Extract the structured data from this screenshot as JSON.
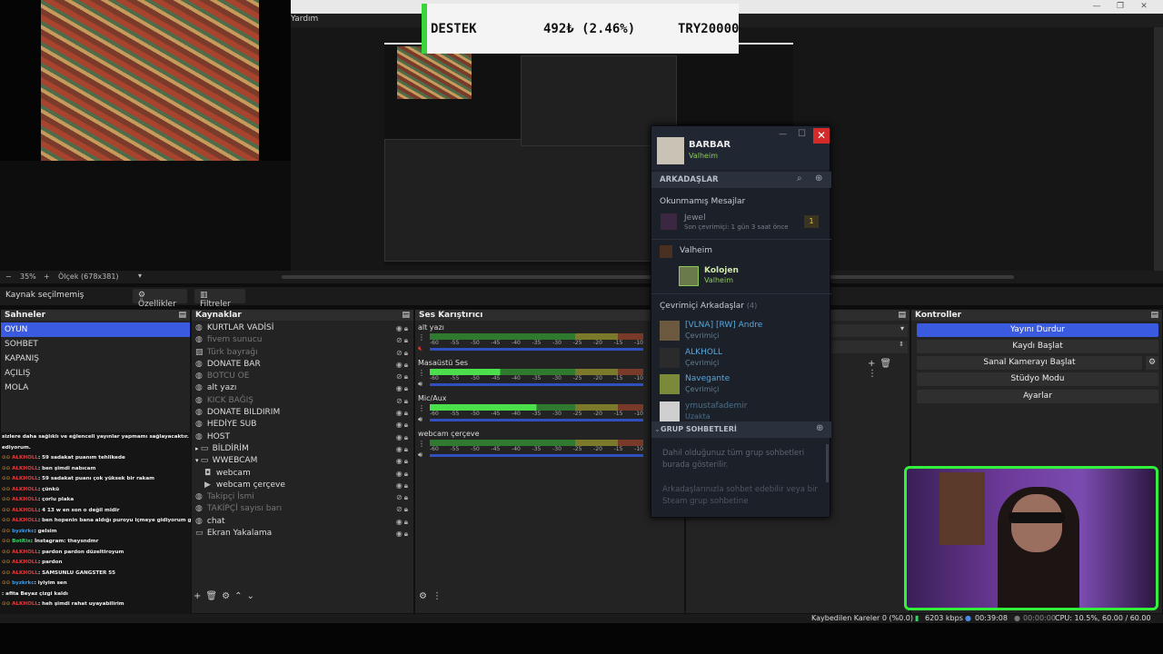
{
  "menu": {
    "help": "Yardım"
  },
  "donation": {
    "label": "DESTEK",
    "progress": "492₺ (2.46%)",
    "goal": "TRY20000"
  },
  "scalebar": {
    "zoom": "35%",
    "scale": "Ölçek (678x381)",
    "minus": "−",
    "plus": "+"
  },
  "source_bar": {
    "none_selected": "Kaynak seçilmemiş",
    "properties": "Özellikler",
    "filters": "Filtreler"
  },
  "scenes": {
    "title": "Sahneler",
    "items": [
      {
        "label": "OYUN",
        "selected": true
      },
      {
        "label": "SOHBET"
      },
      {
        "label": "KAPANIŞ"
      },
      {
        "label": "AÇILIŞ"
      },
      {
        "label": "MOLA"
      }
    ]
  },
  "sources": {
    "title": "Kaynaklar",
    "items": [
      {
        "label": "KURTLAR VADİSİ",
        "icon": "globe"
      },
      {
        "label": "fivem sunucu",
        "icon": "globe",
        "dim": true
      },
      {
        "label": "Türk bayrağı",
        "icon": "image",
        "dim": true
      },
      {
        "label": "DONATE BAR",
        "icon": "globe"
      },
      {
        "label": "BOTCU OE",
        "icon": "globe",
        "dim": true
      },
      {
        "label": "alt yazı",
        "icon": "globe"
      },
      {
        "label": "KICK BAĞIŞ",
        "icon": "globe",
        "dim": true
      },
      {
        "label": "DONATE BILDIRIM",
        "icon": "globe"
      },
      {
        "label": "HEDİYE SUB",
        "icon": "globe"
      },
      {
        "label": "HOST",
        "icon": "globe"
      },
      {
        "label": "BİLDİRİM",
        "icon": "folder",
        "group": "closed"
      },
      {
        "label": "WWEBCAM",
        "icon": "folder",
        "group": "open"
      },
      {
        "label": "webcam",
        "icon": "camera",
        "indent": true
      },
      {
        "label": "webcam çerçeve",
        "icon": "play",
        "indent": true
      },
      {
        "label": "Takipçi İsmi",
        "icon": "globe",
        "dim": true
      },
      {
        "label": "TAKİPÇİ sayısı barı",
        "icon": "globe",
        "dim": true
      },
      {
        "label": "chat",
        "icon": "globe"
      },
      {
        "label": "Ekran Yakalama",
        "icon": "monitor"
      }
    ]
  },
  "mixer": {
    "title": "Ses Karıştırıcı",
    "ticks": [
      "-60",
      "-55",
      "-50",
      "-45",
      "-40",
      "-35",
      "-30",
      "-25",
      "-20",
      "-15",
      "-10"
    ],
    "channels": [
      {
        "name": "alt yazı",
        "level": 0,
        "muted": true
      },
      {
        "name": "Masaüstü Ses",
        "level": 0.33
      },
      {
        "name": "Mic/Aux",
        "level": 0.5
      },
      {
        "name": "webcam çerçeve",
        "level": 0
      }
    ]
  },
  "controls": {
    "title": "Kontroller",
    "buttons": [
      "Yayını Durdur",
      "Kaydı Başlat",
      "Sanal Kamerayı Başlat",
      "Stüdyo Modu",
      "Ayarlar"
    ]
  },
  "chat": [
    {
      "user": "",
      "text": "sizlere daha sağlıklı ve eğlenceli yayınlar yapmamı sağlayacaktır. Şimdiden teşekkür",
      "cls": "m"
    },
    {
      "user": "",
      "text": "ediyorum.",
      "cls": "m"
    },
    {
      "user": "ALKHOLL",
      "text": ": 59 sadakat puanım tehlikede",
      "cls": "u-red"
    },
    {
      "user": "ALKHOLL",
      "text": ": ben şimdi nabıcam",
      "cls": "u-red"
    },
    {
      "user": "ALKHOLL",
      "text": ": 59 sadakat puanı çok yüksek bir rakam",
      "cls": "u-red"
    },
    {
      "user": "ALKHOLL",
      "text": ": çünkü",
      "cls": "u-red"
    },
    {
      "user": "ALKHOLL",
      "text": ": çorlu plaka",
      "cls": "u-red"
    },
    {
      "user": "ALKHOLL",
      "text": ": 4 13 w en son o değil midir",
      "cls": "u-red"
    },
    {
      "user": "ALKHOLL",
      "text": ": ben hopenin bana aldığı puroyu içmeye gidiyorum gelecem",
      "cls": "u-red"
    },
    {
      "user": "byzkrkc",
      "text": ": gelsim",
      "cls": "u-blue"
    },
    {
      "user": "BotRix",
      "text": ": İnstagram: theysndmr",
      "cls": "u-green"
    },
    {
      "user": "ALKHOLL",
      "text": ": pardon pardon düzeltiroyum",
      "cls": "u-red"
    },
    {
      "user": "ALKHOLL",
      "text": ": pardon",
      "cls": "u-red"
    },
    {
      "user": "ALKHOLL",
      "text": ": SAMSUNLU GANGSTER 55",
      "cls": "u-red"
    },
    {
      "user": "byzkrkc",
      "text": ": iyiyim sen",
      "cls": "u-blue"
    },
    {
      "user": "",
      "text": ": afita Beyaz çizgi kaldı",
      "cls": "u-red"
    },
    {
      "user": "ALKHOLL",
      "text": ": heh şimdi rahat uyayabilirim",
      "cls": "u-red"
    }
  ],
  "steam": {
    "user": "BARBAR",
    "user_game": "Valheim",
    "friends_label": "ARKADAŞLAR",
    "unread_title": "Okunmamış Mesajlar",
    "unread_name": "Jewel",
    "unread_sub": "Son çevrimiçi: 1 gün 3 saat önce",
    "unread_count": "1",
    "game_group": "Valheim",
    "game_friend": "Kolojen",
    "game_friend_game": "Valheim",
    "online_title": "Çevrimiçi Arkadaşlar",
    "online_count": "(4)",
    "online": [
      {
        "name": "[VLNA] [RW] Andre",
        "status": "Çevrimiçi"
      },
      {
        "name": "ALKHOLL",
        "status": "Çevrimiçi"
      },
      {
        "name": "Navegante",
        "status": "Çevrimiçi"
      },
      {
        "name": "ymustafademir",
        "status": "Uzakta"
      }
    ],
    "group_title": "GRUP SOHBETLERİ",
    "group_text1": "Dahil olduğunuz tüm grup sohbetleri burada gösterilir.",
    "group_text2": "Arkadaşlarınızla sohbet edebilir veya bir Steam grup sohbetine"
  },
  "status": {
    "dropped": "Kaybedilen Kareler 0 (%0.0)",
    "bitrate": "6203 kbps",
    "live_time": "00:39:08",
    "rec_time": "00:00:00",
    "cpu": "CPU: 10.5%, 60.00 / 60.00 FPS"
  },
  "colors": {
    "accent": "#3a5ae0",
    "steam_bg": "#1b2029",
    "cam_border": "#33f03a",
    "donation_bar": "#38d63a"
  }
}
